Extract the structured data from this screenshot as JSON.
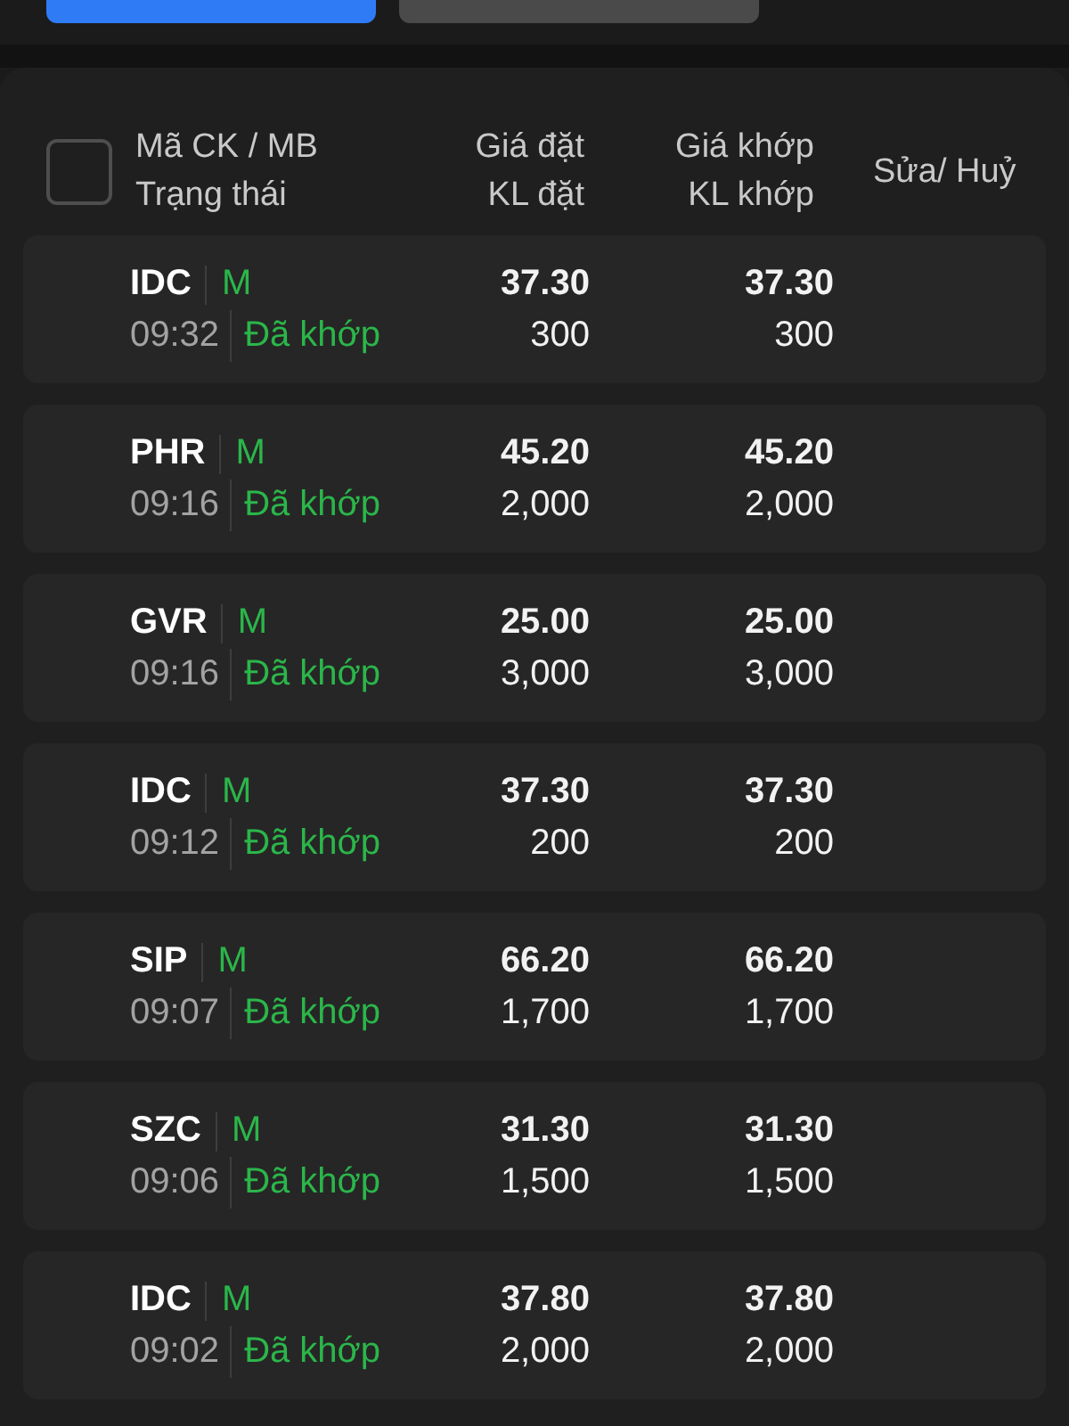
{
  "tabs": [
    {
      "selected": true
    },
    {
      "selected": false
    }
  ],
  "order_table": {
    "select_all": {
      "checked": false
    },
    "columns": [
      {
        "lines": [
          "Mã CK / MB",
          "Trạng thái"
        ]
      },
      {
        "lines": [
          "Giá đặt",
          "KL đặt"
        ]
      },
      {
        "lines": [
          "Giá khớp",
          "KL khớp"
        ]
      },
      {
        "lines": [
          "Sửa/ Huỷ"
        ]
      }
    ],
    "rows": [
      {
        "symbol": "IDC",
        "side": "M",
        "time": "09:32",
        "status": "Đã khớp",
        "order_price": "37.30",
        "order_qty": "300",
        "match_price": "37.30",
        "match_qty": "300"
      },
      {
        "symbol": "PHR",
        "side": "M",
        "time": "09:16",
        "status": "Đã khớp",
        "order_price": "45.20",
        "order_qty": "2,000",
        "match_price": "45.20",
        "match_qty": "2,000"
      },
      {
        "symbol": "GVR",
        "side": "M",
        "time": "09:16",
        "status": "Đã khớp",
        "order_price": "25.00",
        "order_qty": "3,000",
        "match_price": "25.00",
        "match_qty": "3,000"
      },
      {
        "symbol": "IDC",
        "side": "M",
        "time": "09:12",
        "status": "Đã khớp",
        "order_price": "37.30",
        "order_qty": "200",
        "match_price": "37.30",
        "match_qty": "200"
      },
      {
        "symbol": "SIP",
        "side": "M",
        "time": "09:07",
        "status": "Đã khớp",
        "order_price": "66.20",
        "order_qty": "1,700",
        "match_price": "66.20",
        "match_qty": "1,700"
      },
      {
        "symbol": "SZC",
        "side": "M",
        "time": "09:06",
        "status": "Đã khớp",
        "order_price": "31.30",
        "order_qty": "1,500",
        "match_price": "31.30",
        "match_qty": "1,500"
      },
      {
        "symbol": "IDC",
        "side": "M",
        "time": "09:02",
        "status": "Đã khớp",
        "order_price": "37.80",
        "order_qty": "2,000",
        "match_price": "37.80",
        "match_qty": "2,000"
      }
    ]
  }
}
